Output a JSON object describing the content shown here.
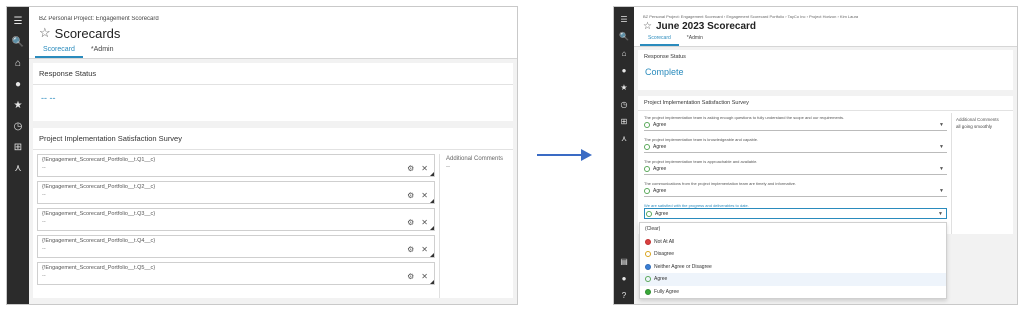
{
  "left": {
    "breadcrumb": "BZ Personal Project: Engagement Scorecard",
    "title": "Scorecards",
    "tabs": [
      "Scorecard",
      "*Admin"
    ],
    "response_status": {
      "title": "Response Status",
      "value": "-- --"
    },
    "survey": {
      "title": "Project Implementation Satisfaction Survey",
      "questions": [
        {
          "label": "{!Engagement_Scorecard_Portfolio__t.Q1__c}",
          "value": "--"
        },
        {
          "label": "{!Engagement_Scorecard_Portfolio__t.Q2__c}",
          "value": "--"
        },
        {
          "label": "{!Engagement_Scorecard_Portfolio__t.Q3__c}",
          "value": "--"
        },
        {
          "label": "{!Engagement_Scorecard_Portfolio__t.Q4__c}",
          "value": "--"
        },
        {
          "label": "{!Engagement_Scorecard_Portfolio__t.Q5__c}",
          "value": "--"
        }
      ],
      "comments_label": "Additional Comments",
      "comments_value": "--"
    }
  },
  "right": {
    "breadcrumb": "BZ Personal Project: Engagement Scorecard  ›  Engagement Scorecard Portfolio  ›  TayCo Inc  ›  Project Horizon  ›  Kim Laura",
    "title": "June 2023 Scorecard",
    "tabs": [
      "Scorecard",
      "*Admin"
    ],
    "response_status": {
      "title": "Response Status",
      "value": "Complete"
    },
    "survey": {
      "title": "Project Implementation Satisfaction Survey",
      "questions": [
        {
          "label": "The project implementation team is asking enough questions to fully understand the scope and our requirements.",
          "value": "Agree"
        },
        {
          "label": "The project implementation team is knowledgeable and capable.",
          "value": "Agree"
        },
        {
          "label": "The project implementation team is approachable and available.",
          "value": "Agree"
        },
        {
          "label": "The communications from the project implementation team are timely and informative.",
          "value": "Agree"
        },
        {
          "label": "We are satisfied with the progress and deliverables to date.",
          "value": "Agree"
        }
      ],
      "comments_label": "Additional Comments",
      "comments_value": "all going smoothly"
    },
    "dropdown_options": [
      "(Clear)",
      "Not At All",
      "Disagree",
      "Neither Agree or Disagree",
      "Agree",
      "Fully Agree"
    ]
  },
  "colors": {
    "accent": "#2a8bbd",
    "sidebar": "#2b2b2b",
    "arrow": "#3a6bc4"
  }
}
